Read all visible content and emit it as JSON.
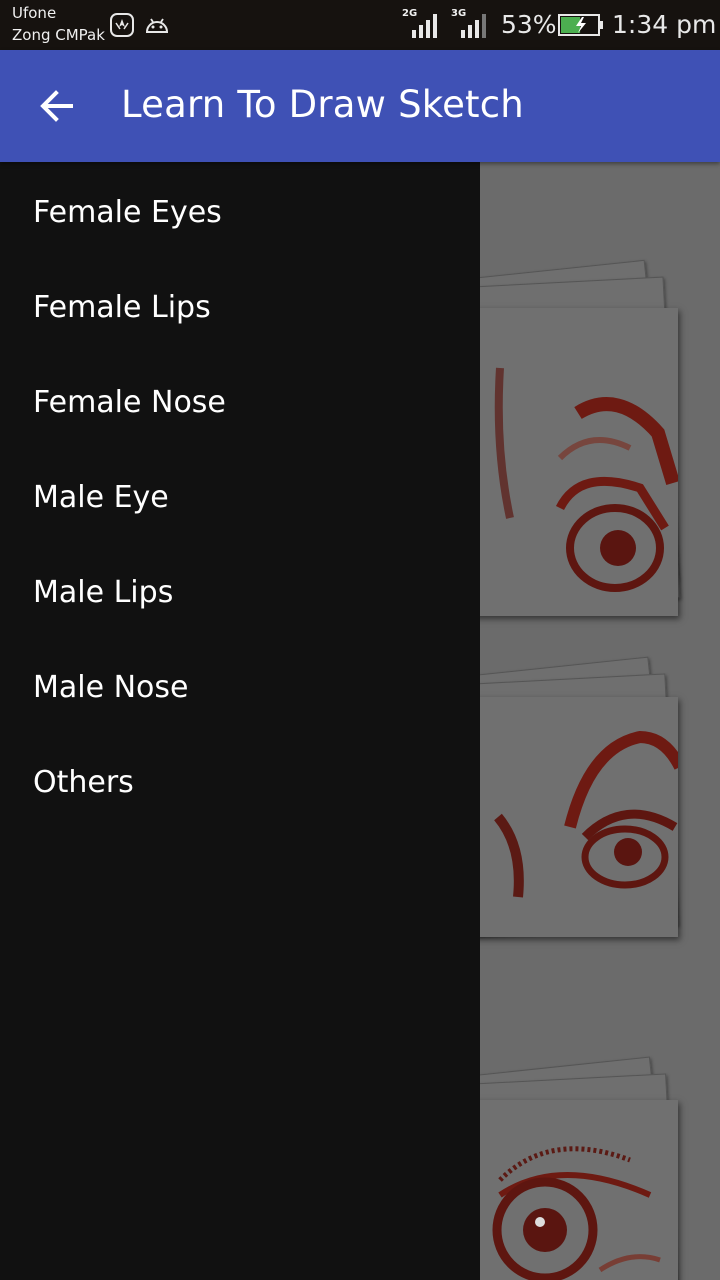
{
  "status_bar": {
    "carrier_1": "Ufone",
    "carrier_2": "Zong CMPak",
    "icons": [
      "huawei-icon",
      "android-icon"
    ],
    "network_1_label": "2G",
    "network_2_label": "3G",
    "battery_percent": "53%",
    "battery_level": 0.53,
    "battery_charging": true,
    "time": "1:34 pm"
  },
  "toolbar": {
    "title": "Learn To Draw Sketch",
    "back_icon": "arrow-left-icon",
    "color": "#3f51b5"
  },
  "drawer": {
    "items": [
      {
        "label": "Female Eyes"
      },
      {
        "label": "Female Lips"
      },
      {
        "label": "Female Nose"
      },
      {
        "label": "Male Eye"
      },
      {
        "label": "Male Lips"
      },
      {
        "label": "Male Nose"
      },
      {
        "label": "Others"
      }
    ]
  },
  "content": {
    "cards": [
      {
        "image": "eye-sketch-image"
      },
      {
        "image": "eye-sketch-image"
      },
      {
        "image": "eye-sketch-image"
      }
    ],
    "sketch_color": "#7a1c14"
  }
}
